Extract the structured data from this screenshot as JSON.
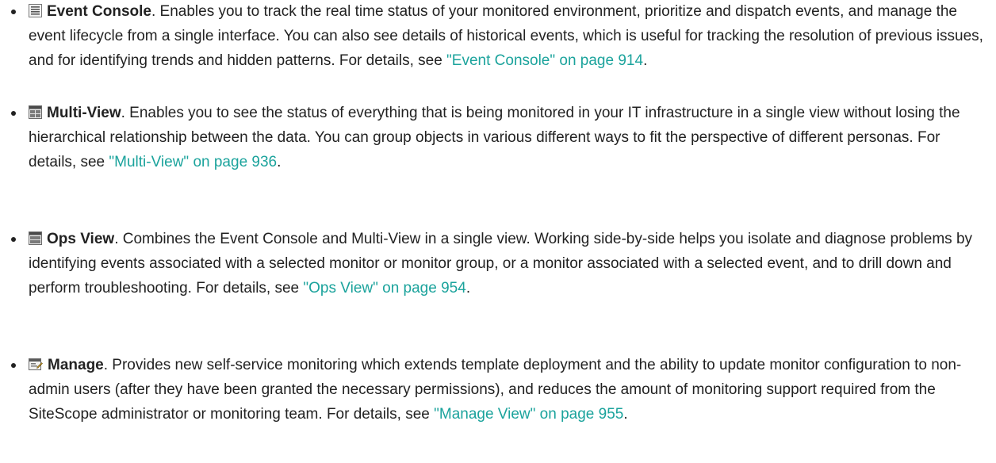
{
  "items": [
    {
      "icon": "event-console-icon",
      "name": "Event Console",
      "text": ". Enables you to track the real time status of your monitored environment, prioritize and dispatch events, and manage the event lifecycle from a single interface. You can also see details of historical events, which is useful for tracking the resolution of previous issues, and for identifying trends and hidden patterns. For details, see ",
      "link": "\"Event Console\" on page 914",
      "end": "."
    },
    {
      "icon": "multi-view-icon",
      "name": "Multi-View",
      "text": ". Enables you to see the status of everything that is being monitored in your IT infrastructure in a single view without losing the hierarchical relationship between the data. You can group objects in various different ways to fit the perspective of different personas. For details, see ",
      "link": "\"Multi-View\" on page 936",
      "end": "."
    },
    {
      "icon": "ops-view-icon",
      "name": "Ops View",
      "text": ". Combines the Event Console and Multi-View in a single view. Working side-by-side helps you isolate and diagnose problems by identifying events associated with a selected monitor or monitor group, or a monitor associated with a selected event, and to drill down and perform troubleshooting. For details, see ",
      "link": "\"Ops View\" on page 954",
      "end": "."
    },
    {
      "icon": "manage-icon",
      "name": "Manage",
      "text": ". Provides new self-service monitoring which extends template deployment and the ability to update monitor configuration to non-admin users (after they have been granted the necessary permissions), and reduces the amount of monitoring support required from the SiteScope administrator or monitoring team. For details, see ",
      "link": "\"Manage View\" on page 955",
      "end": "."
    }
  ],
  "colors": {
    "text": "#222222",
    "link": "#1ba39c"
  }
}
